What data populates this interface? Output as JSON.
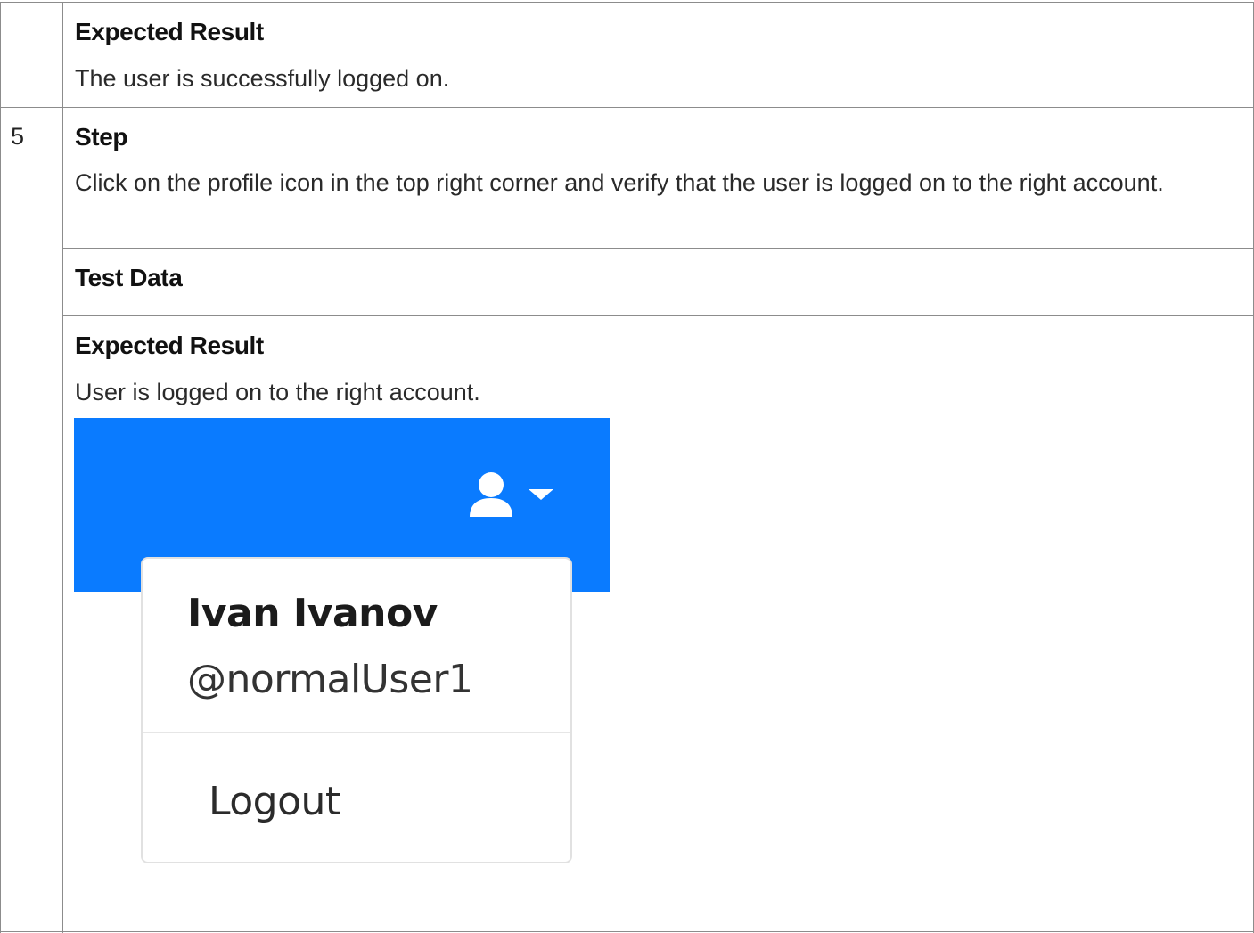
{
  "rows": [
    {
      "number": "",
      "sections": [
        {
          "heading": "Expected Result",
          "text": "The user is successfully logged on."
        }
      ]
    },
    {
      "number": "5",
      "sections": [
        {
          "heading": "Step",
          "text": "Click on the profile icon in the top right corner and verify that the user is logged on to the right account."
        },
        {
          "heading": "Test Data",
          "text": ""
        },
        {
          "heading": "Expected Result",
          "text": "User is logged on to the right account."
        }
      ]
    }
  ],
  "screenshot": {
    "header_color": "#0a7bff",
    "profile_icon": "user-icon",
    "dropdown_icon": "caret-down-icon",
    "menu": {
      "user_name": "Ivan Ivanov",
      "username": "@normalUser1",
      "logout_label": "Logout"
    }
  }
}
